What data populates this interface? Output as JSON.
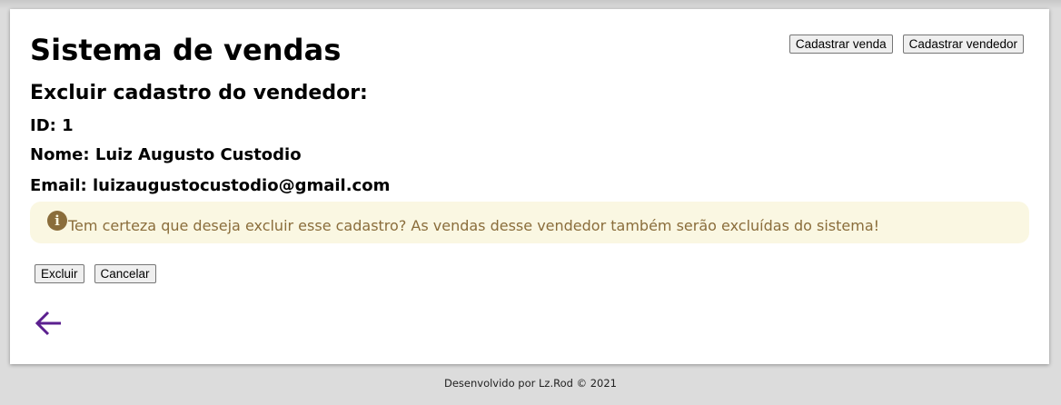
{
  "header": {
    "title": "Sistema de vendas",
    "nav": {
      "register_sale_label": "Cadastrar venda",
      "register_seller_label": "Cadastrar vendedor"
    }
  },
  "main": {
    "heading": "Excluir cadastro do vendedor:",
    "seller": {
      "id_text": "ID: 1",
      "name_text": "Nome: Luiz Augusto Custodio",
      "email_text": "Email: luizaugustocustodio@gmail.com"
    },
    "warning": {
      "icon": "info-icon",
      "icon_glyph": "i",
      "text": "Tem certeza que deseja excluir esse cadastro? As vendas desse vendedor também serão excluídas do sistema!"
    },
    "actions": {
      "delete_label": "Excluir",
      "cancel_label": "Cancelar"
    },
    "back_icon": "arrow-left-icon"
  },
  "footer": {
    "text": "Desenvolvido por Lz.Rod © 2021"
  },
  "colors": {
    "page_background": "#dcdcdc",
    "card_background": "#ffffff",
    "warning_background": "#faf7e2",
    "warning_text": "#8a6d3b",
    "back_arrow": "#5b1f8f"
  }
}
